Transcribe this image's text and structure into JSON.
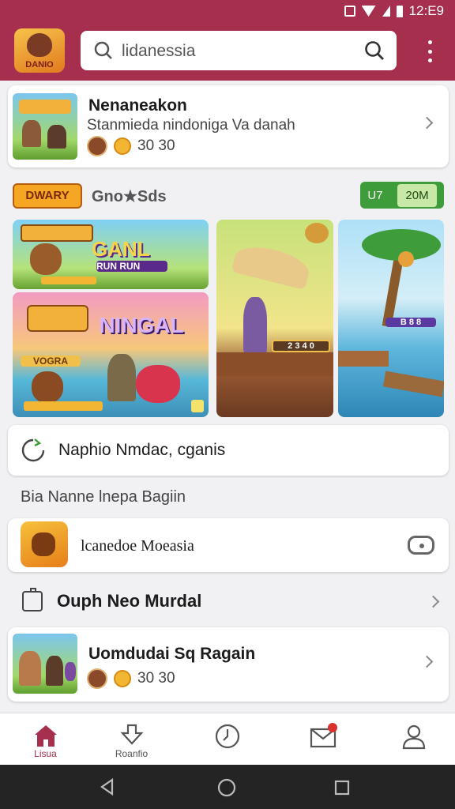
{
  "status": {
    "time": "12:E9"
  },
  "appbar": {
    "logo_text": "DANIO",
    "search_text": "lidanessia"
  },
  "top_card": {
    "title": "Nenaneakon",
    "subtitle": "Stanmieda nindoniga Va danah",
    "meta_value": "30 30"
  },
  "feature": {
    "logo": "DWARY",
    "label": "Gno★Sds",
    "pill_left": "U7",
    "pill_right": "20M"
  },
  "tiles": {
    "tile1_title": "GANL",
    "tile1_sub": "RUN RUN",
    "tile2_title": "NINGAL",
    "tile2_tag": "VOGRA",
    "tile3_badge": "2 3 4 0",
    "tile4_badge": "B 8 8"
  },
  "search_card": {
    "text": "Naphio Nmdac, cganis"
  },
  "section_1": {
    "label": "Bia Nanne lnepa Bagiin"
  },
  "game_card": {
    "text": "lcanedoe Moeasia"
  },
  "section_2": {
    "label": "Ouph Neo Murdal"
  },
  "bottom_card": {
    "title": "Uomdudai Sq Ragain",
    "meta_value": "30 30"
  },
  "tabs": [
    {
      "label": "Lisua"
    },
    {
      "label": "Roanfio"
    },
    {
      "label": ""
    },
    {
      "label": ""
    },
    {
      "label": ""
    }
  ],
  "colors": {
    "brand": "#a62f4e",
    "pill_green": "#3e9d3a",
    "notif_red": "#d9322e"
  }
}
